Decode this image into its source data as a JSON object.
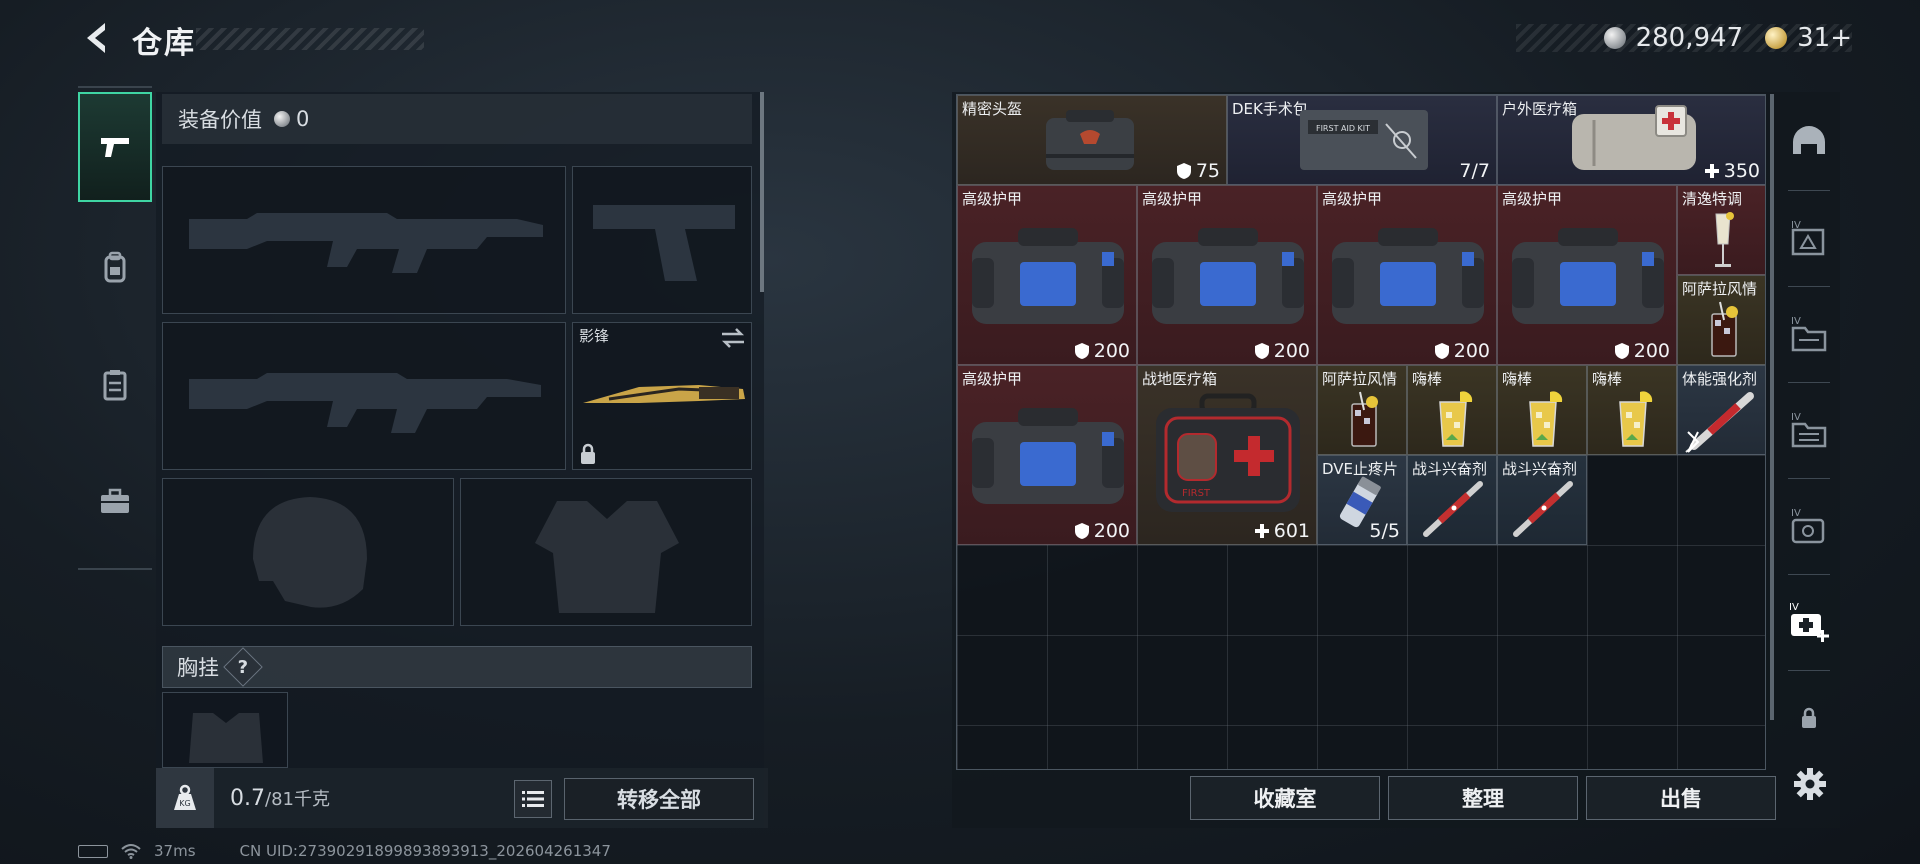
{
  "header": {
    "title": "仓库",
    "currency_silver": "280,947",
    "currency_gold": "31+"
  },
  "left_panel": {
    "tabs": [
      {
        "icon": "pistol-icon",
        "active": true
      },
      {
        "icon": "backpack-icon",
        "active": false
      },
      {
        "icon": "vest-icon",
        "active": false
      },
      {
        "icon": "toolbox-icon",
        "active": false
      }
    ],
    "equip_value_label": "装备价值",
    "equip_value": "0",
    "melee_slot_name": "影锋",
    "chest_rig_label": "胸挂",
    "chest_rig_help": "?",
    "weight_current": "0.7",
    "weight_max": "/81千克",
    "transfer_all": "转移全部"
  },
  "stash": {
    "items": [
      {
        "name": "精密头盔",
        "stat": "75",
        "stat_icon": "shield-icon"
      },
      {
        "name": "DEK手术包",
        "stat": "7/7",
        "stat_icon": ""
      },
      {
        "name": "户外医疗箱",
        "stat": "350",
        "stat_icon": "plus-icon"
      },
      {
        "name": "高级护甲",
        "stat": "200",
        "stat_icon": "shield-icon"
      },
      {
        "name": "高级护甲",
        "stat": "200",
        "stat_icon": "shield-icon"
      },
      {
        "name": "高级护甲",
        "stat": "200",
        "stat_icon": "shield-icon"
      },
      {
        "name": "高级护甲",
        "stat": "200",
        "stat_icon": "shield-icon"
      },
      {
        "name": "清逸特调",
        "stat": "",
        "stat_icon": ""
      },
      {
        "name": "阿萨拉风情",
        "stat": "",
        "stat_icon": ""
      },
      {
        "name": "高级护甲",
        "stat": "200",
        "stat_icon": "shield-icon"
      },
      {
        "name": "战地医疗箱",
        "stat": "601",
        "stat_icon": "plus-icon"
      },
      {
        "name": "阿萨拉风情",
        "stat": "",
        "stat_icon": ""
      },
      {
        "name": "嗨棒",
        "stat": "",
        "stat_icon": ""
      },
      {
        "name": "嗨棒",
        "stat": "",
        "stat_icon": ""
      },
      {
        "name": "嗨棒",
        "stat": "",
        "stat_icon": ""
      },
      {
        "name": "体能强化剂",
        "stat": "",
        "stat_icon": ""
      },
      {
        "name": "DVE止疼片",
        "stat": "5/5",
        "stat_icon": ""
      },
      {
        "name": "战斗兴奋剂",
        "stat": "",
        "stat_icon": ""
      },
      {
        "name": "战斗兴奋剂",
        "stat": "",
        "stat_icon": ""
      }
    ]
  },
  "right_tabs": [
    {
      "icon": "helmet-tab-icon"
    },
    {
      "icon": "stash-tab-4-icon"
    },
    {
      "icon": "stash-tab-3-icon"
    },
    {
      "icon": "stash-tab-2-icon"
    },
    {
      "icon": "stash-tab-1-icon"
    },
    {
      "icon": "medical-tab-icon"
    },
    {
      "icon": "locked-tab-icon"
    }
  ],
  "bottom_buttons": {
    "collection": "收藏室",
    "organize": "整理",
    "sell": "出售"
  },
  "status_bar": {
    "ping": "37ms",
    "uid": "CN UID:27390291899893893913_202604261347"
  },
  "colors": {
    "accent": "#3fd5a3",
    "armor_bg": "#4a2226",
    "helmet_bg": "#3a3228",
    "kit_bg": "#2a2e40"
  }
}
